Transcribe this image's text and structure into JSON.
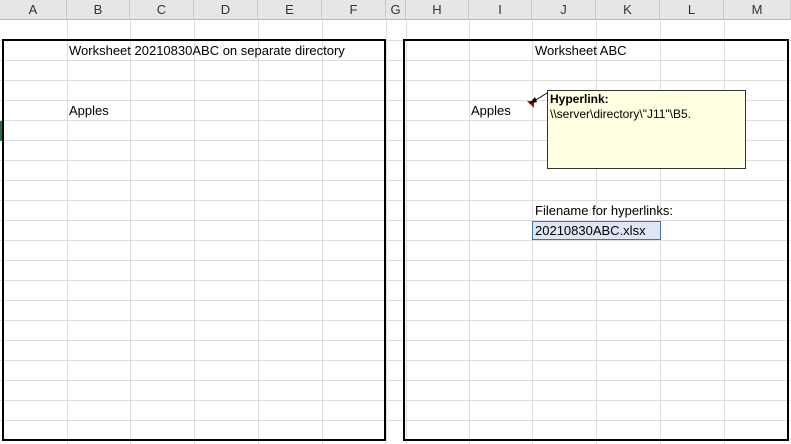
{
  "columns": [
    "A",
    "B",
    "C",
    "D",
    "E",
    "F",
    "G",
    "H",
    "I",
    "J",
    "K",
    "L",
    "M"
  ],
  "left_panel": {
    "title": "Worksheet 20210830ABC on separate directory",
    "item": "Apples"
  },
  "right_panel": {
    "title": "Worksheet ABC",
    "item": "Apples",
    "comment": {
      "title": "Hyperlink:",
      "body": "\\\\server\\directory\\\"J11\"\\B5."
    },
    "filename_label": "Filename for hyperlinks:",
    "filename_value": "20210830ABC.xlsx"
  },
  "colors": {
    "header_bg": "#e6e6e6",
    "gridline": "#dedede",
    "comment_bg": "#ffffe1",
    "selected_cell_bg": "#dde6f5",
    "comment_indicator": "#cc0000"
  }
}
